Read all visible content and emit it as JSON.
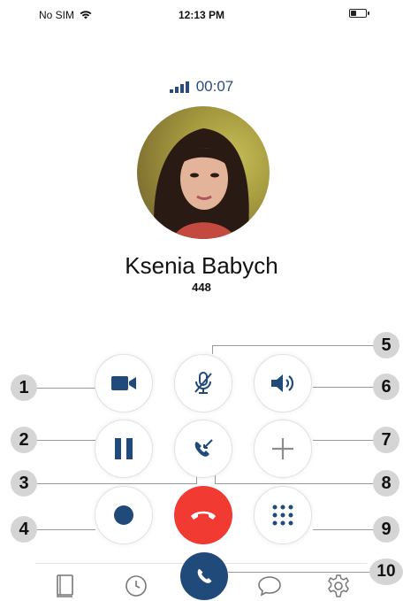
{
  "status_bar": {
    "carrier": "No SIM",
    "time": "12:13 PM",
    "battery_level": 0.35
  },
  "call": {
    "duration": "00:07",
    "contact_name": "Ksenia Babych",
    "extension": "448"
  },
  "callouts": [
    "1",
    "2",
    "3",
    "4",
    "5",
    "6",
    "7",
    "8",
    "9",
    "10"
  ],
  "icons": {
    "video": "video-camera-icon",
    "mute": "microphone-off-icon",
    "speaker": "speaker-icon",
    "hold": "pause-icon",
    "transfer": "transfer-call-icon",
    "add": "plus-icon",
    "record": "record-icon",
    "end": "hang-up-icon",
    "keypad": "keypad-icon",
    "contacts": "book-icon",
    "recents": "clock-icon",
    "call": "phone-icon",
    "chat": "chat-bubble-icon",
    "settings": "gear-icon"
  },
  "colors": {
    "accent": "#1f4a7a",
    "end_call": "#f13a32",
    "timer": "#2a4c7d"
  }
}
